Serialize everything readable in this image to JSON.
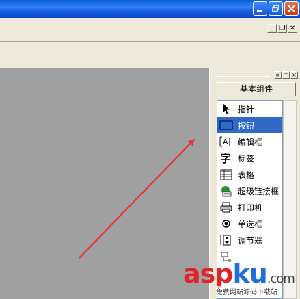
{
  "panel": {
    "basic_components_label": "基本组件"
  },
  "components": [
    {
      "label": "指针",
      "icon": "pointer-icon"
    },
    {
      "label": "按钮",
      "icon": "button-icon",
      "selected": true
    },
    {
      "label": "编辑框",
      "icon": "edit-box-icon"
    },
    {
      "label": "标签",
      "icon": "label-icon"
    },
    {
      "label": "表格",
      "icon": "table-icon"
    },
    {
      "label": "超级链接框",
      "icon": "hyperlink-icon"
    },
    {
      "label": "打印机",
      "icon": "printer-icon"
    },
    {
      "label": "单选框",
      "icon": "radio-icon"
    },
    {
      "label": "调节器",
      "icon": "spinner-icon"
    },
    {
      "label": "",
      "icon": "component-icon"
    }
  ],
  "watermark": {
    "brand_red": "asp",
    "brand_blue": "ku",
    "brand_tail": ".com",
    "subtitle": "免费网站源码下载站"
  },
  "colors": {
    "selection": "#316ac5",
    "arrow": "#e23a3a",
    "client_area": "#a0a0a0"
  }
}
